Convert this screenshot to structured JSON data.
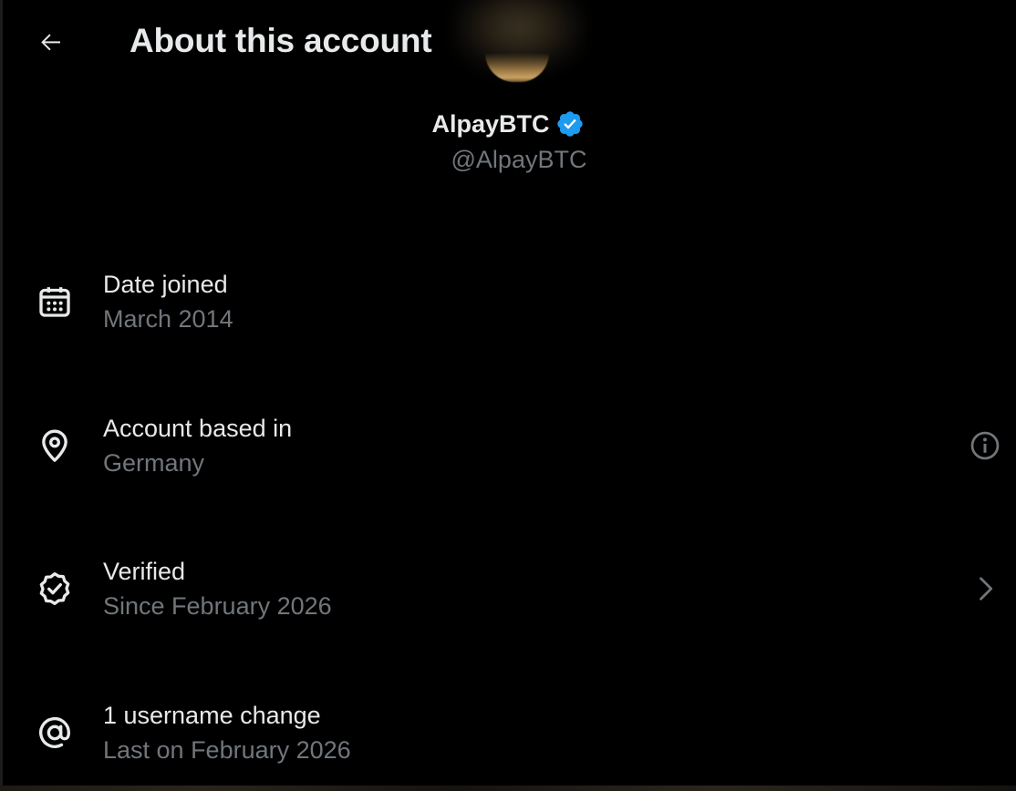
{
  "header": {
    "title": "About this account",
    "back_icon": "arrow-left-icon"
  },
  "profile": {
    "display_name": "AlpayBTC",
    "handle": "@AlpayBTC",
    "verified_badge_color": "#1d9bf0"
  },
  "rows": [
    {
      "icon": "calendar-icon",
      "title": "Date joined",
      "subtitle": "March 2014"
    },
    {
      "icon": "location-pin-icon",
      "title": "Account based in",
      "subtitle": "Germany",
      "action_icon": "info-icon"
    },
    {
      "icon": "verified-check-icon",
      "title": "Verified",
      "subtitle": "Since February 2026",
      "action_icon": "chevron-right-icon"
    },
    {
      "icon": "at-sign-icon",
      "title": "1 username change",
      "subtitle": "Last on February 2026"
    }
  ],
  "colors": {
    "background": "#000000",
    "primary_text": "#e7e9ea",
    "secondary_text": "#71767b",
    "accent": "#1d9bf0"
  }
}
